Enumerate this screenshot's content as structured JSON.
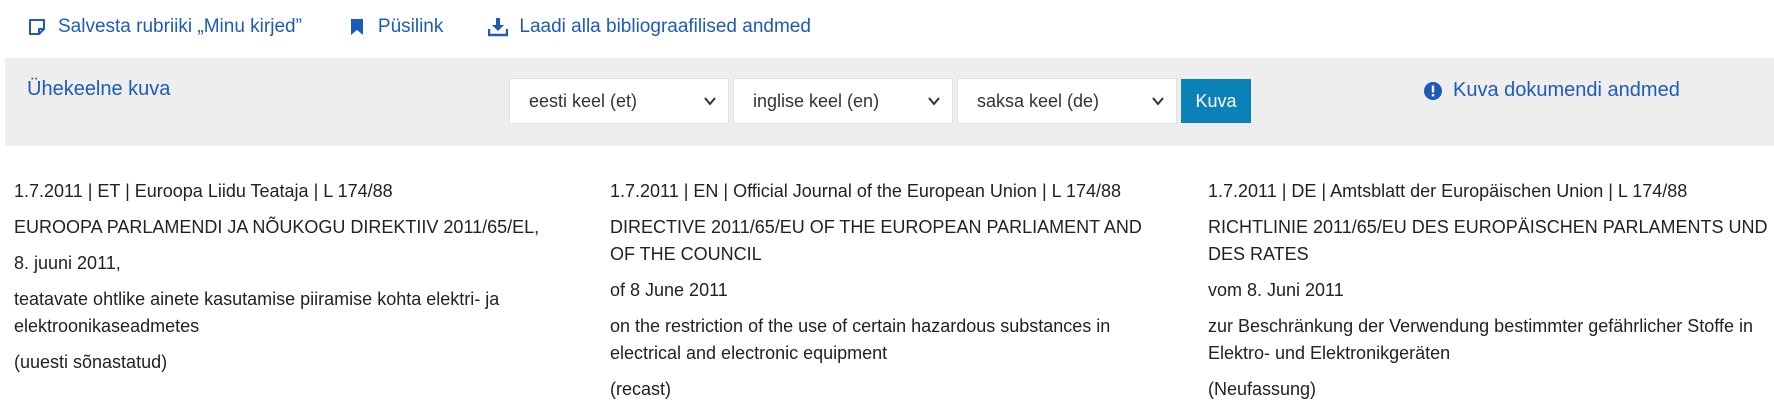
{
  "top_links": {
    "save": "Salvesta rubriiki „Minu kirjed”",
    "permalink": "Püsilink",
    "download": "Laadi alla bibliograafilised andmed"
  },
  "toolbar": {
    "monolingual": "Ühekeelne kuva",
    "lang1": "eesti keel (et)",
    "lang2": "inglise keel (en)",
    "lang3": "saksa keel (de)",
    "show_button": "Kuva",
    "doc_data": "Kuva dokumendi andmed"
  },
  "columns": [
    {
      "meta": "1.7.2011    | ET | Euroopa Liidu Teataja | L 174/88",
      "title": "EUROOPA PARLAMENDI JA NÕUKOGU DIREKTIIV 2011/65/EL,",
      "date": "8. juuni 2011,",
      "subject": "teatavate ohtlike ainete kasutamise piiramise kohta elektri- ja elektroonikaseadmetes",
      "note": "(uuesti sõnastatud)"
    },
    {
      "meta": "1.7.2011    | EN | Official Journal of the European Union | L 174/88",
      "title": "DIRECTIVE 2011/65/EU OF THE EUROPEAN PARLIAMENT AND OF THE COUNCIL",
      "date": "of 8 June 2011",
      "subject": "on the restriction of the use of certain hazardous substances in electrical and electronic equipment",
      "note": "(recast)"
    },
    {
      "meta": "1.7.2011    | DE | Amtsblatt der Europäischen Union | L 174/88",
      "title": "RICHTLINIE 2011/65/EU DES EUROPÄISCHEN PARLAMENTS UND DES RATES",
      "date": "vom 8. Juni 2011",
      "subject": "zur Beschränkung der Verwendung bestimmter gefährlicher Stoffe in Elektro- und Elektronikgeräten",
      "note": "(Neufassung)"
    }
  ],
  "colors": {
    "link": "#1e5bb8",
    "button": "#0a82b8",
    "toolbar_bg": "#eeeeee"
  }
}
